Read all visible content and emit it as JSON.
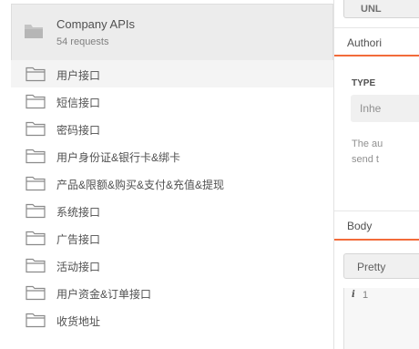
{
  "collection": {
    "title": "Company APIs",
    "count": "54 requests"
  },
  "folders": [
    {
      "label": "用户接口"
    },
    {
      "label": "短信接口"
    },
    {
      "label": "密码接口"
    },
    {
      "label": "用户身份证&银行卡&绑卡"
    },
    {
      "label": "产品&限额&购买&支付&充值&提现"
    },
    {
      "label": "系统接口"
    },
    {
      "label": "广告接口"
    },
    {
      "label": "活动接口"
    },
    {
      "label": "用户资金&订单接口"
    },
    {
      "label": "收货地址"
    }
  ],
  "right_panel": {
    "undo_label": "UNL",
    "auth_tab": "Authori",
    "type_label": "TYPE",
    "type_value": "Inhe",
    "auth_desc_line1": "The au",
    "auth_desc_line2": "send t",
    "body_tab": "Body",
    "pretty_label": "Pretty",
    "gutter_info": "i",
    "line_number": "1"
  },
  "colors": {
    "accent": "#f26b3a",
    "header_bg": "#ececec",
    "text": "#505050"
  },
  "icons": {
    "folder": "folder-icon",
    "collection": "collection-folder-icon"
  }
}
